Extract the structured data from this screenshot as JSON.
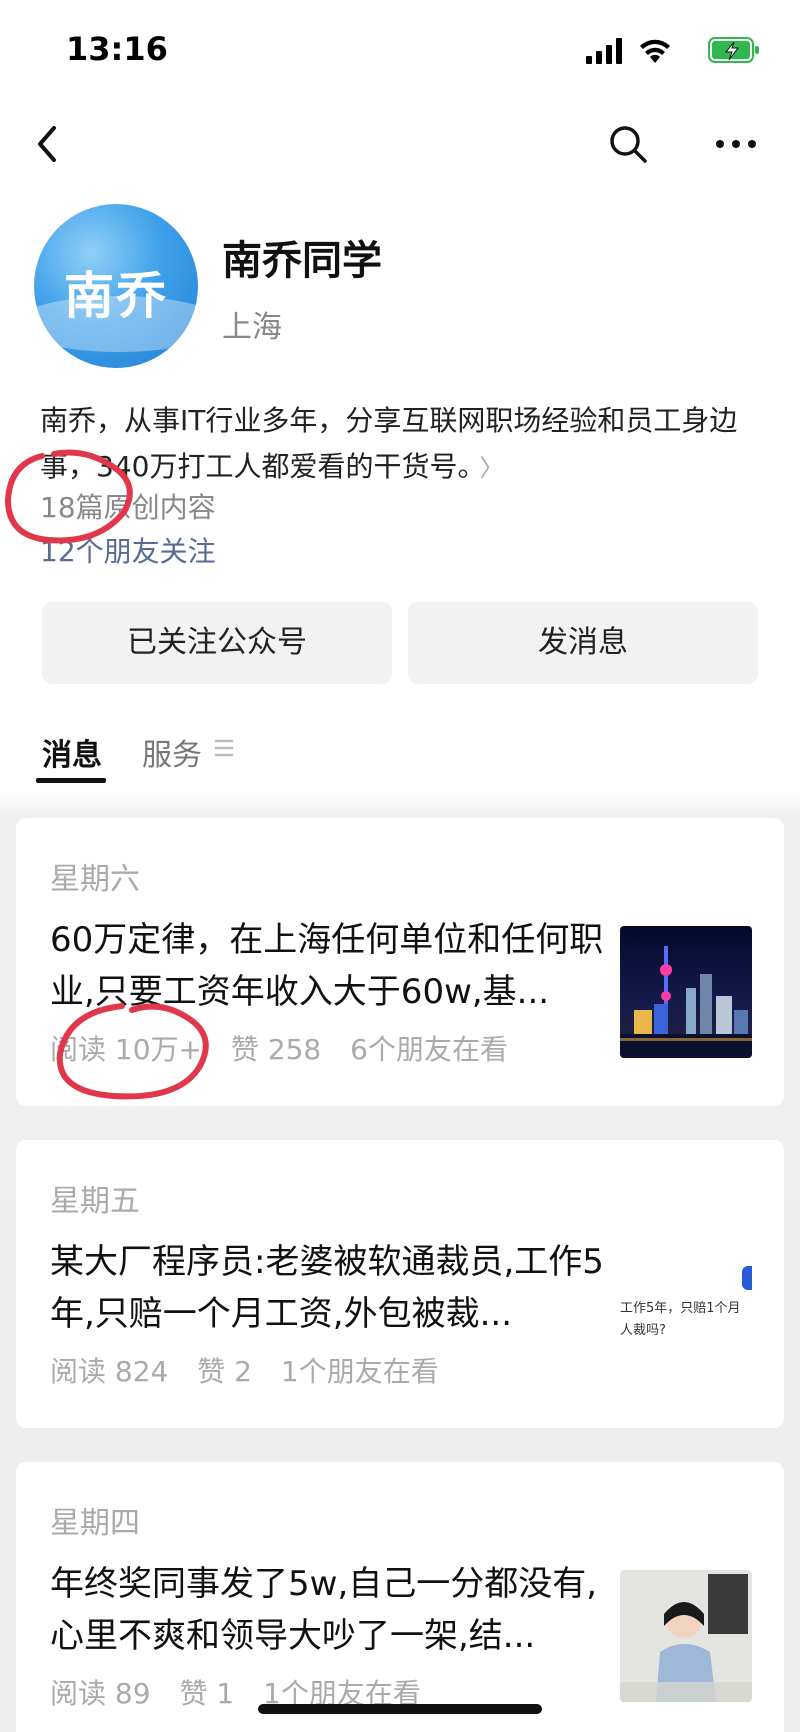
{
  "status_bar": {
    "time": "13:16",
    "icons": [
      "signal-icon",
      "wifi-icon",
      "battery-charging-icon"
    ],
    "battery_color": "#2fb84f"
  },
  "nav": {
    "icons": [
      "back-icon",
      "search-icon",
      "more-icon"
    ]
  },
  "profile": {
    "avatar_text": "南乔",
    "name": "南乔同学",
    "location": "上海",
    "description": "南乔，从事IT行业多年，分享互联网职场经验和员工身边事，340万打工人都爱看的干货号。",
    "original_count": "18篇原创内容",
    "friends_follow": "12个朋友关注"
  },
  "actions": {
    "follow_label": "已关注公众号",
    "message_label": "发消息"
  },
  "tabs": {
    "messages": "消息",
    "services": "服务"
  },
  "articles": [
    {
      "day": "星期六",
      "title": "60万定律，在上海任何单位和任何职业,只要工资年收入大于60w,基...",
      "reads": "阅读 10万+",
      "likes": "赞 258",
      "friends": "6个朋友在看"
    },
    {
      "day": "星期五",
      "title": "某大厂程序员:老婆被软通裁员,工作5年,只赔一个月工资,外包被裁...",
      "reads": "阅读 824",
      "likes": "赞 2",
      "friends": "1个朋友在看",
      "thumb_text": "工作5年，只赔1个月\n人裁吗?"
    },
    {
      "day": "星期四",
      "title": "年终奖同事发了5w,自己一分都没有,心里不爽和领导大吵了一架,结...",
      "reads": "阅读 89",
      "likes": "赞 1",
      "friends": "1个朋友在看"
    }
  ],
  "colors": {
    "link": "#576b95",
    "annotation": "#e0384a",
    "muted": "#aaaaaa"
  }
}
